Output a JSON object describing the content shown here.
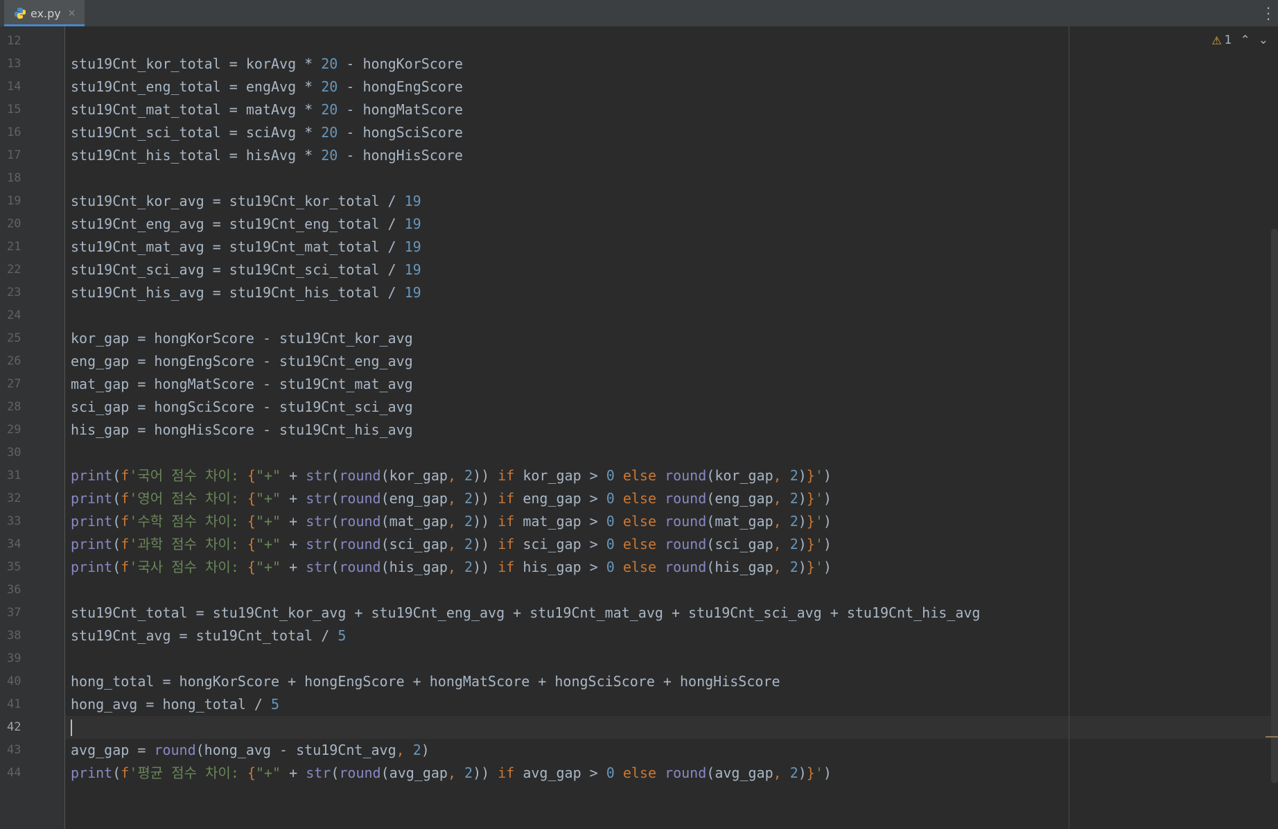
{
  "tab": {
    "label": "ex.py",
    "close": "×"
  },
  "inspections": {
    "warning_count": "1",
    "up": "⌃",
    "down": "⌄"
  },
  "current_line": 42,
  "lines": [
    {
      "no": "12",
      "tokens": []
    },
    {
      "no": "13",
      "tokens": [
        [
          "t",
          "stu19Cnt_kor_total = korAvg * "
        ],
        [
          "num",
          "20"
        ],
        [
          "t",
          " - hongKorScore"
        ]
      ]
    },
    {
      "no": "14",
      "tokens": [
        [
          "t",
          "stu19Cnt_eng_total = engAvg * "
        ],
        [
          "num",
          "20"
        ],
        [
          "t",
          " - hongEngScore"
        ]
      ]
    },
    {
      "no": "15",
      "tokens": [
        [
          "t",
          "stu19Cnt_mat_total = matAvg * "
        ],
        [
          "num",
          "20"
        ],
        [
          "t",
          " - hongMatScore"
        ]
      ]
    },
    {
      "no": "16",
      "tokens": [
        [
          "t",
          "stu19Cnt_sci_total = sciAvg * "
        ],
        [
          "num",
          "20"
        ],
        [
          "t",
          " - hongSciScore"
        ]
      ]
    },
    {
      "no": "17",
      "tokens": [
        [
          "t",
          "stu19Cnt_his_total = hisAvg * "
        ],
        [
          "num",
          "20"
        ],
        [
          "t",
          " - hongHisScore"
        ]
      ]
    },
    {
      "no": "18",
      "tokens": []
    },
    {
      "no": "19",
      "tokens": [
        [
          "t",
          "stu19Cnt_kor_avg = stu19Cnt_kor_total / "
        ],
        [
          "num",
          "19"
        ]
      ]
    },
    {
      "no": "20",
      "tokens": [
        [
          "t",
          "stu19Cnt_eng_avg = stu19Cnt_eng_total / "
        ],
        [
          "num",
          "19"
        ]
      ]
    },
    {
      "no": "21",
      "tokens": [
        [
          "t",
          "stu19Cnt_mat_avg = stu19Cnt_mat_total / "
        ],
        [
          "num",
          "19"
        ]
      ]
    },
    {
      "no": "22",
      "tokens": [
        [
          "t",
          "stu19Cnt_sci_avg = stu19Cnt_sci_total / "
        ],
        [
          "num",
          "19"
        ]
      ]
    },
    {
      "no": "23",
      "tokens": [
        [
          "t",
          "stu19Cnt_his_avg = stu19Cnt_his_total / "
        ],
        [
          "num",
          "19"
        ]
      ]
    },
    {
      "no": "24",
      "tokens": []
    },
    {
      "no": "25",
      "tokens": [
        [
          "t",
          "kor_gap = hongKorScore - stu19Cnt_kor_avg"
        ]
      ]
    },
    {
      "no": "26",
      "tokens": [
        [
          "t",
          "eng_gap = hongEngScore - stu19Cnt_eng_avg"
        ]
      ]
    },
    {
      "no": "27",
      "tokens": [
        [
          "t",
          "mat_gap = hongMatScore - stu19Cnt_mat_avg"
        ]
      ]
    },
    {
      "no": "28",
      "tokens": [
        [
          "t",
          "sci_gap = hongSciScore - stu19Cnt_sci_avg"
        ]
      ]
    },
    {
      "no": "29",
      "tokens": [
        [
          "t",
          "his_gap = hongHisScore - stu19Cnt_his_avg"
        ]
      ]
    },
    {
      "no": "30",
      "tokens": []
    },
    {
      "no": "31",
      "tokens": [
        [
          "bi",
          "print"
        ],
        [
          "t",
          "("
        ],
        [
          "fx",
          "f"
        ],
        [
          "str",
          "'국어 점수 차이: "
        ],
        [
          "fx",
          "{"
        ],
        [
          "str",
          "\"+\""
        ],
        [
          "t",
          " + "
        ],
        [
          "bi",
          "str"
        ],
        [
          "t",
          "("
        ],
        [
          "bi",
          "round"
        ],
        [
          "t",
          "(kor_gap"
        ],
        [
          "kw",
          ", "
        ],
        [
          "num",
          "2"
        ],
        [
          "t",
          ")) "
        ],
        [
          "kw",
          "if"
        ],
        [
          "t",
          " kor_gap > "
        ],
        [
          "num",
          "0"
        ],
        [
          "t",
          " "
        ],
        [
          "kw",
          "else"
        ],
        [
          "t",
          " "
        ],
        [
          "bi",
          "round"
        ],
        [
          "t",
          "(kor_gap"
        ],
        [
          "kw",
          ", "
        ],
        [
          "num",
          "2"
        ],
        [
          "t",
          ")"
        ],
        [
          "fx",
          "}"
        ],
        [
          "str",
          "'"
        ],
        [
          "t",
          ")"
        ]
      ]
    },
    {
      "no": "32",
      "tokens": [
        [
          "bi",
          "print"
        ],
        [
          "t",
          "("
        ],
        [
          "fx",
          "f"
        ],
        [
          "str",
          "'영어 점수 차이: "
        ],
        [
          "fx",
          "{"
        ],
        [
          "str",
          "\"+\""
        ],
        [
          "t",
          " + "
        ],
        [
          "bi",
          "str"
        ],
        [
          "t",
          "("
        ],
        [
          "bi",
          "round"
        ],
        [
          "t",
          "(eng_gap"
        ],
        [
          "kw",
          ", "
        ],
        [
          "num",
          "2"
        ],
        [
          "t",
          ")) "
        ],
        [
          "kw",
          "if"
        ],
        [
          "t",
          " eng_gap > "
        ],
        [
          "num",
          "0"
        ],
        [
          "t",
          " "
        ],
        [
          "kw",
          "else"
        ],
        [
          "t",
          " "
        ],
        [
          "bi",
          "round"
        ],
        [
          "t",
          "(eng_gap"
        ],
        [
          "kw",
          ", "
        ],
        [
          "num",
          "2"
        ],
        [
          "t",
          ")"
        ],
        [
          "fx",
          "}"
        ],
        [
          "str",
          "'"
        ],
        [
          "t",
          ")"
        ]
      ]
    },
    {
      "no": "33",
      "tokens": [
        [
          "bi",
          "print"
        ],
        [
          "t",
          "("
        ],
        [
          "fx",
          "f"
        ],
        [
          "str",
          "'수학 점수 차이: "
        ],
        [
          "fx",
          "{"
        ],
        [
          "str",
          "\"+\""
        ],
        [
          "t",
          " + "
        ],
        [
          "bi",
          "str"
        ],
        [
          "t",
          "("
        ],
        [
          "bi",
          "round"
        ],
        [
          "t",
          "(mat_gap"
        ],
        [
          "kw",
          ", "
        ],
        [
          "num",
          "2"
        ],
        [
          "t",
          ")) "
        ],
        [
          "kw",
          "if"
        ],
        [
          "t",
          " mat_gap > "
        ],
        [
          "num",
          "0"
        ],
        [
          "t",
          " "
        ],
        [
          "kw",
          "else"
        ],
        [
          "t",
          " "
        ],
        [
          "bi",
          "round"
        ],
        [
          "t",
          "(mat_gap"
        ],
        [
          "kw",
          ", "
        ],
        [
          "num",
          "2"
        ],
        [
          "t",
          ")"
        ],
        [
          "fx",
          "}"
        ],
        [
          "str",
          "'"
        ],
        [
          "t",
          ")"
        ]
      ]
    },
    {
      "no": "34",
      "tokens": [
        [
          "bi",
          "print"
        ],
        [
          "t",
          "("
        ],
        [
          "fx",
          "f"
        ],
        [
          "str",
          "'과학 점수 차이: "
        ],
        [
          "fx",
          "{"
        ],
        [
          "str",
          "\"+\""
        ],
        [
          "t",
          " + "
        ],
        [
          "bi",
          "str"
        ],
        [
          "t",
          "("
        ],
        [
          "bi",
          "round"
        ],
        [
          "t",
          "(sci_gap"
        ],
        [
          "kw",
          ", "
        ],
        [
          "num",
          "2"
        ],
        [
          "t",
          ")) "
        ],
        [
          "kw",
          "if"
        ],
        [
          "t",
          " sci_gap > "
        ],
        [
          "num",
          "0"
        ],
        [
          "t",
          " "
        ],
        [
          "kw",
          "else"
        ],
        [
          "t",
          " "
        ],
        [
          "bi",
          "round"
        ],
        [
          "t",
          "(sci_gap"
        ],
        [
          "kw",
          ", "
        ],
        [
          "num",
          "2"
        ],
        [
          "t",
          ")"
        ],
        [
          "fx",
          "}"
        ],
        [
          "str",
          "'"
        ],
        [
          "t",
          ")"
        ]
      ]
    },
    {
      "no": "35",
      "tokens": [
        [
          "bi",
          "print"
        ],
        [
          "t",
          "("
        ],
        [
          "fx",
          "f"
        ],
        [
          "str",
          "'국사 점수 차이: "
        ],
        [
          "fx",
          "{"
        ],
        [
          "str",
          "\"+\""
        ],
        [
          "t",
          " + "
        ],
        [
          "bi",
          "str"
        ],
        [
          "t",
          "("
        ],
        [
          "bi",
          "round"
        ],
        [
          "t",
          "(his_gap"
        ],
        [
          "kw",
          ", "
        ],
        [
          "num",
          "2"
        ],
        [
          "t",
          ")) "
        ],
        [
          "kw",
          "if"
        ],
        [
          "t",
          " his_gap > "
        ],
        [
          "num",
          "0"
        ],
        [
          "t",
          " "
        ],
        [
          "kw",
          "else"
        ],
        [
          "t",
          " "
        ],
        [
          "bi",
          "round"
        ],
        [
          "t",
          "(his_gap"
        ],
        [
          "kw",
          ", "
        ],
        [
          "num",
          "2"
        ],
        [
          "t",
          ")"
        ],
        [
          "fx",
          "}"
        ],
        [
          "str",
          "'"
        ],
        [
          "t",
          ")"
        ]
      ]
    },
    {
      "no": "36",
      "tokens": []
    },
    {
      "no": "37",
      "tokens": [
        [
          "t",
          "stu19Cnt_total = stu19Cnt_kor_avg + stu19Cnt_eng_avg + stu19Cnt_mat_avg + stu19Cnt_sci_avg + stu19Cnt_his_avg"
        ]
      ]
    },
    {
      "no": "38",
      "tokens": [
        [
          "t",
          "stu19Cnt_avg = stu19Cnt_total / "
        ],
        [
          "num",
          "5"
        ]
      ]
    },
    {
      "no": "39",
      "tokens": []
    },
    {
      "no": "40",
      "tokens": [
        [
          "t",
          "hong_total = hongKorScore + hongEngScore + hongMatScore + hongSciScore + hongHisScore"
        ]
      ]
    },
    {
      "no": "41",
      "tokens": [
        [
          "t",
          "hong_avg = hong_total / "
        ],
        [
          "num",
          "5"
        ]
      ]
    },
    {
      "no": "42",
      "tokens": []
    },
    {
      "no": "43",
      "tokens": [
        [
          "t",
          "avg_gap = "
        ],
        [
          "bi",
          "round"
        ],
        [
          "t",
          "(hong_avg - stu19Cnt_avg"
        ],
        [
          "kw",
          ", "
        ],
        [
          "num",
          "2"
        ],
        [
          "t",
          ")"
        ]
      ]
    },
    {
      "no": "44",
      "tokens": [
        [
          "bi",
          "print"
        ],
        [
          "t",
          "("
        ],
        [
          "fx",
          "f"
        ],
        [
          "str",
          "'평균 점수 차이: "
        ],
        [
          "fx",
          "{"
        ],
        [
          "str",
          "\"+\""
        ],
        [
          "t",
          " + "
        ],
        [
          "bi",
          "str"
        ],
        [
          "t",
          "("
        ],
        [
          "bi",
          "round"
        ],
        [
          "t",
          "(avg_gap"
        ],
        [
          "kw",
          ", "
        ],
        [
          "num",
          "2"
        ],
        [
          "t",
          ")) "
        ],
        [
          "kw",
          "if"
        ],
        [
          "t",
          " avg_gap > "
        ],
        [
          "num",
          "0"
        ],
        [
          "t",
          " "
        ],
        [
          "kw",
          "else"
        ],
        [
          "t",
          " "
        ],
        [
          "bi",
          "round"
        ],
        [
          "t",
          "(avg_gap"
        ],
        [
          "kw",
          ", "
        ],
        [
          "num",
          "2"
        ],
        [
          "t",
          ")"
        ],
        [
          "fx",
          "}"
        ],
        [
          "str",
          "'"
        ],
        [
          "t",
          ")"
        ]
      ]
    }
  ]
}
